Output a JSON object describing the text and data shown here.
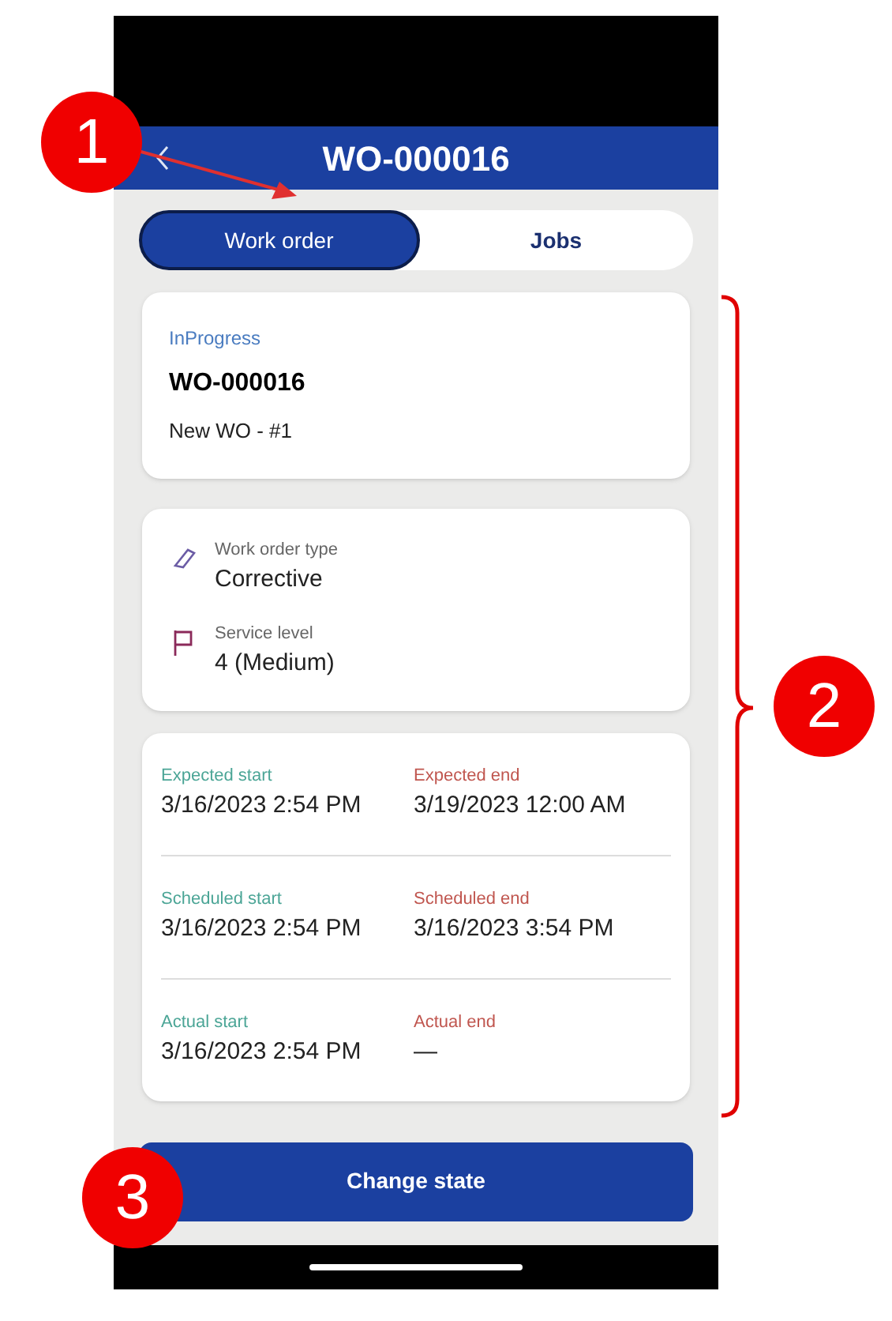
{
  "header": {
    "title": "WO-000016"
  },
  "tabs": [
    {
      "label": "Work order",
      "selected": true
    },
    {
      "label": "Jobs",
      "selected": false
    }
  ],
  "summary": {
    "status": "InProgress",
    "number": "WO-000016",
    "name": "New WO - #1"
  },
  "details": [
    {
      "kind": "tag",
      "label": "Work order type",
      "value": "Corrective"
    },
    {
      "kind": "flag",
      "label": "Service level",
      "value": "4 (Medium)"
    }
  ],
  "dates": [
    [
      {
        "kind": "start",
        "label": "Expected start",
        "value": "3/16/2023 2:54 PM"
      },
      {
        "kind": "end",
        "label": "Expected end",
        "value": "3/19/2023 12:00 AM"
      }
    ],
    [
      {
        "kind": "start",
        "label": "Scheduled start",
        "value": "3/16/2023 2:54 PM"
      },
      {
        "kind": "end",
        "label": "Scheduled end",
        "value": "3/16/2023 3:54 PM"
      }
    ],
    [
      {
        "kind": "start",
        "label": "Actual start",
        "value": "3/16/2023 2:54 PM"
      },
      {
        "kind": "end",
        "label": "Actual end",
        "value": "—"
      }
    ]
  ],
  "action": {
    "label": "Change state"
  },
  "callouts": [
    "1",
    "2",
    "3"
  ]
}
